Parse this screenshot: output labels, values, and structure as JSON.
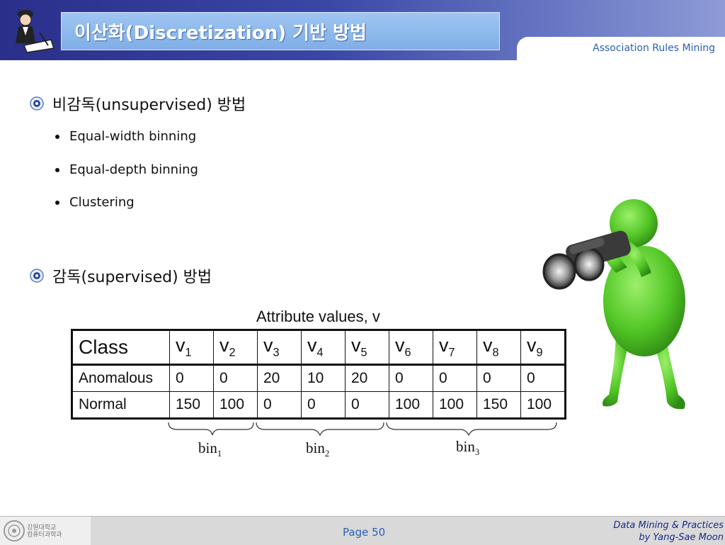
{
  "header": {
    "title": "이산화(Discretization) 기반 방법",
    "tab_text": "Association Rules Mining"
  },
  "bullets": [
    {
      "label": "비감독(unsupervised) 방법",
      "sub": [
        "Equal-width binning",
        "Equal-depth binning",
        "Clustering"
      ]
    },
    {
      "label": "감독(supervised) 방법"
    }
  ],
  "chart_data": {
    "type": "table",
    "title": "Attribute values, v",
    "columns": [
      "Class",
      "v1",
      "v2",
      "v3",
      "v4",
      "v5",
      "v6",
      "v7",
      "v8",
      "v9"
    ],
    "rows": [
      [
        "Anomalous",
        "0",
        "0",
        "20",
        "10",
        "20",
        "0",
        "0",
        "0",
        "0"
      ],
      [
        "Normal",
        "150",
        "100",
        "0",
        "0",
        "0",
        "100",
        "100",
        "150",
        "100"
      ]
    ],
    "bins": [
      "bin1",
      "bin2",
      "bin3"
    ]
  },
  "table": {
    "header_class": "Class",
    "header_var": "v",
    "header_subs": [
      "1",
      "2",
      "3",
      "4",
      "5",
      "6",
      "7",
      "8",
      "9"
    ],
    "bin_base": "bin",
    "bin_subs": [
      "1",
      "2",
      "3"
    ]
  },
  "footer": {
    "page": "Page 50",
    "credit_line1": "Data Mining & Practices",
    "credit_line2": "by Yang-Sae Moon",
    "logo_line1": "강원대학교",
    "logo_line2": "컴퓨터과학과"
  }
}
